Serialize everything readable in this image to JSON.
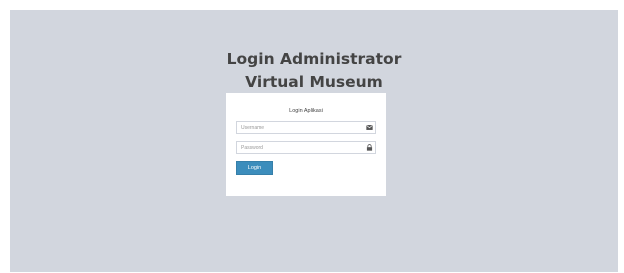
{
  "header": {
    "title_line1": "Login Administrator",
    "title_line2": "Virtual Museum"
  },
  "login_box": {
    "message": "Login Aplikasi",
    "username_placeholder": "Username",
    "username_value": "",
    "username_icon": "envelope-icon",
    "password_placeholder": "Password",
    "password_value": "",
    "password_icon": "lock-icon",
    "submit_label": "Login"
  },
  "colors": {
    "background": "#d2d6de",
    "panel": "#ffffff",
    "button": "#3c8dbc",
    "title": "#444444"
  }
}
